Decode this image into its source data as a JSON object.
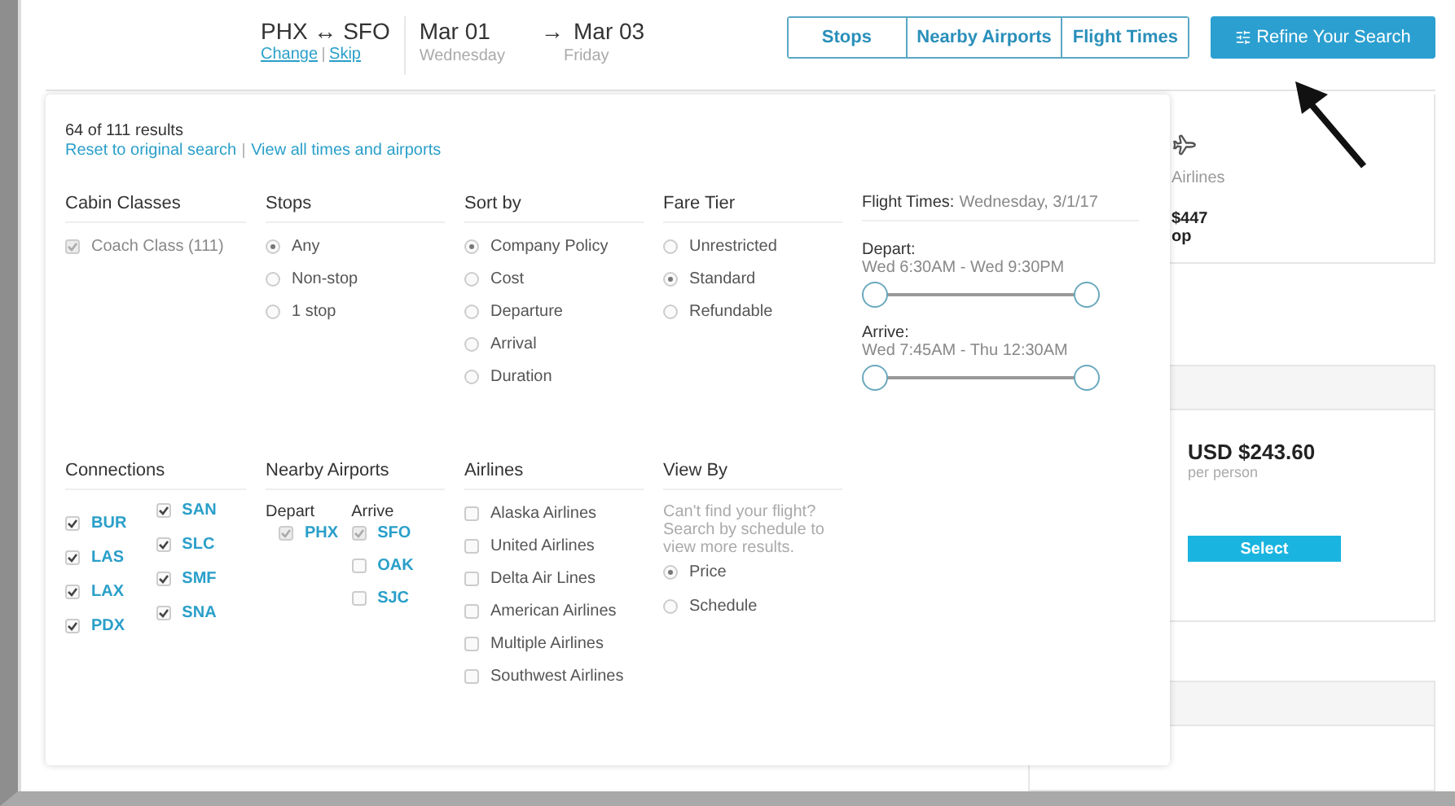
{
  "header": {
    "route": "PHX ↔ SFO",
    "links": [
      "Change",
      "Skip"
    ],
    "dates": [
      {
        "date": "Mar 01",
        "day": "Wednesday"
      },
      {
        "arrow": "→",
        "date": "Mar 03",
        "day": "Friday"
      }
    ]
  },
  "filter_tabs": [
    "Stops",
    "Nearby Airports",
    "Flight Times"
  ],
  "refine_button": "Refine Your Search",
  "results": [
    {
      "kind": "airline",
      "airline": "Airlines",
      "price": "$447",
      "stops": "op"
    },
    {
      "kind": "fare",
      "price": "USD $243.60",
      "note": "per person",
      "button": "Select"
    },
    {
      "kind": "empty"
    }
  ],
  "panel": {
    "summary": "64 of 111 results",
    "links": [
      "Reset to original search",
      "View all times and airports"
    ],
    "sections": [
      {
        "kind": "checks",
        "title": "Cabin Classes",
        "items": [
          {
            "label": "Coach Class (111)",
            "checked": true,
            "disabled": true
          }
        ]
      },
      {
        "kind": "radios",
        "title": "Stops",
        "items": [
          {
            "label": "Any",
            "selected": true
          },
          {
            "label": "Non-stop",
            "selected": false
          },
          {
            "label": "1 stop",
            "selected": false
          }
        ]
      },
      {
        "kind": "radios",
        "title": "Sort by",
        "items": [
          {
            "label": "Company Policy",
            "selected": true
          },
          {
            "label": "Cost",
            "selected": false
          },
          {
            "label": "Departure",
            "selected": false
          },
          {
            "label": "Arrival",
            "selected": false
          },
          {
            "label": "Duration",
            "selected": false
          }
        ]
      },
      {
        "kind": "radios",
        "title": "Fare Tier",
        "items": [
          {
            "label": "Unrestricted",
            "selected": false
          },
          {
            "label": "Standard",
            "selected": true
          },
          {
            "label": "Refundable",
            "selected": false
          }
        ]
      },
      {
        "kind": "times",
        "title": "Flight Times:",
        "subtitle": "Wednesday, 3/1/17",
        "ranges": [
          {
            "label": "Depart:",
            "range": "Wed 6:30AM - Wed 9:30PM",
            "thumbs": [
              {
                "level": 0
              },
              {
                "level": 1
              }
            ]
          },
          {
            "label": "Arrive:",
            "range": "Wed 7:45AM - Thu 12:30AM",
            "thumbs": [
              {
                "level": 0
              },
              {
                "level": 1
              }
            ]
          }
        ]
      },
      {
        "kind": "connections",
        "title": "Connections",
        "columns": [
          [
            {
              "label": "BUR",
              "checked": true
            },
            {
              "label": "LAS",
              "checked": true
            },
            {
              "label": "LAX",
              "checked": true
            },
            {
              "label": "PDX",
              "checked": true
            }
          ],
          [
            {
              "label": "SAN",
              "checked": true
            },
            {
              "label": "SLC",
              "checked": true
            },
            {
              "label": "SMF",
              "checked": true
            },
            {
              "label": "SNA",
              "checked": true
            }
          ]
        ]
      },
      {
        "kind": "nearby",
        "title": "Nearby Airports",
        "groups": [
          {
            "label": "Depart",
            "items": [
              {
                "label": "PHX",
                "checked": true,
                "disabled": true
              }
            ]
          },
          {
            "label": "Arrive",
            "items": [
              {
                "label": "SFO",
                "checked": true,
                "disabled": true
              },
              {
                "label": "OAK",
                "checked": false,
                "disabled": false
              },
              {
                "label": "SJC",
                "checked": false,
                "disabled": false
              }
            ]
          }
        ]
      },
      {
        "kind": "checks",
        "title": "Airlines",
        "items": [
          {
            "label": "Alaska Airlines",
            "checked": false
          },
          {
            "label": "United Airlines",
            "checked": false
          },
          {
            "label": "Delta Air Lines",
            "checked": false
          },
          {
            "label": "American Airlines",
            "checked": false
          },
          {
            "label": "Multiple Airlines",
            "checked": false
          },
          {
            "label": "Southwest Airlines",
            "checked": false
          }
        ]
      },
      {
        "kind": "viewby",
        "title": "View By",
        "note": "Can't find your flight? Search by schedule to view more results.",
        "items": [
          {
            "label": "Price",
            "selected": true
          },
          {
            "label": "Schedule",
            "selected": false
          }
        ]
      }
    ]
  }
}
